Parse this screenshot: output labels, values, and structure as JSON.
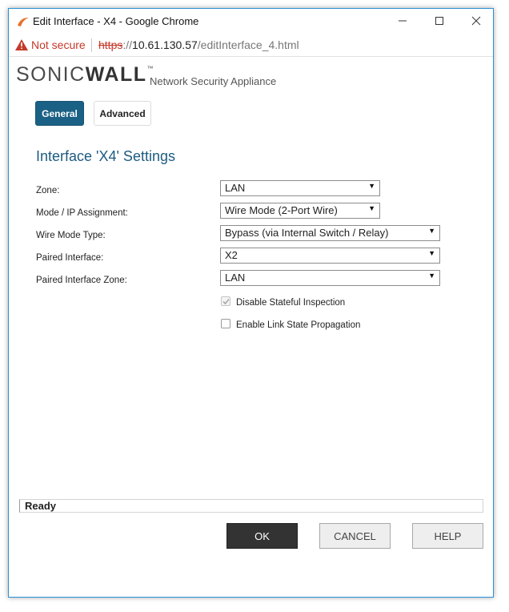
{
  "window": {
    "title": "Edit Interface - X4 - Google Chrome",
    "minimize_glyph": "—",
    "maximize_glyph": "☐",
    "close_glyph": "✕"
  },
  "address": {
    "security_label": "Not secure",
    "url_scheme": "https",
    "url_separator": "://",
    "url_host": "10.61.130.57",
    "url_path": "/editInterface_4.html"
  },
  "brand": {
    "logo_sonic": "SONIC",
    "logo_wall": "WALL",
    "logo_tm": "™",
    "tagline": "Network Security Appliance"
  },
  "tabs": [
    {
      "label": "General",
      "active": true
    },
    {
      "label": "Advanced",
      "active": false
    }
  ],
  "form": {
    "title": "Interface 'X4' Settings",
    "fields": [
      {
        "label": "Zone:",
        "value": "LAN"
      },
      {
        "label": "Mode / IP Assignment:",
        "value": "Wire Mode (2-Port Wire)"
      },
      {
        "label": "Wire Mode Type:",
        "value": "Bypass (via Internal Switch / Relay)"
      },
      {
        "label": "Paired Interface:",
        "value": "X2"
      },
      {
        "label": "Paired Interface Zone:",
        "value": "LAN"
      }
    ],
    "checkboxes": [
      {
        "label": "Disable Stateful Inspection",
        "checked": true,
        "disabled": true
      },
      {
        "label": "Enable Link State Propagation",
        "checked": false,
        "disabled": false
      }
    ]
  },
  "status": {
    "text": "Ready"
  },
  "buttons": {
    "ok": "OK",
    "cancel": "CANCEL",
    "help": "HELP"
  },
  "colors": {
    "accent": "#1b6186",
    "title_text": "#1d5b80",
    "warning": "#c53929",
    "ok_button": "#333333"
  }
}
